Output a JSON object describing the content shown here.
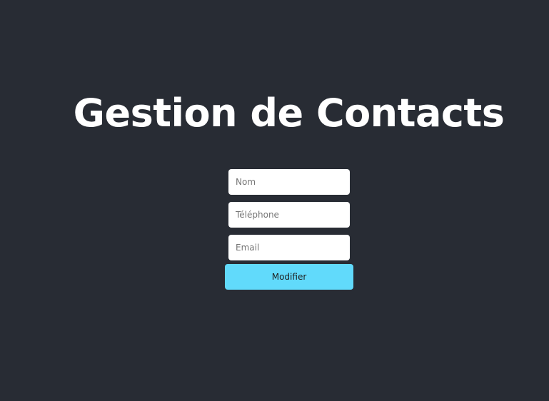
{
  "header": {
    "title": "Gestion de Contacts"
  },
  "form": {
    "name_placeholder": "Nom",
    "phone_placeholder": "Téléphone",
    "email_placeholder": "Email",
    "name_value": "",
    "phone_value": "",
    "email_value": "",
    "submit_label": "Modifier"
  },
  "colors": {
    "background": "#282c34",
    "title": "#ffffff",
    "field_background": "#ffffff",
    "button_background": "#61dafb"
  }
}
